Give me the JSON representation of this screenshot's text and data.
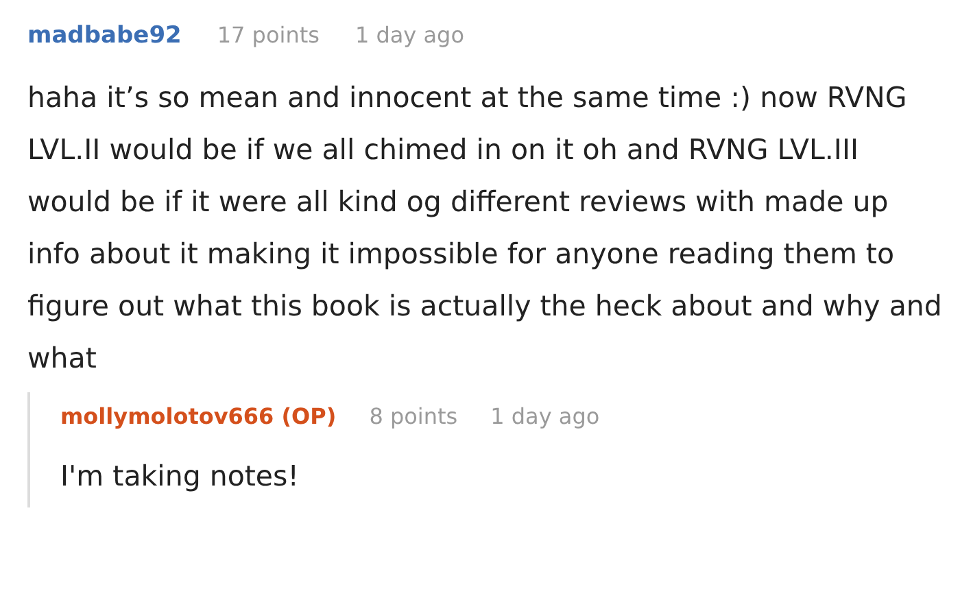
{
  "comments": [
    {
      "username": "madbabe92",
      "op": false,
      "points": "17 points",
      "time": "1 day ago",
      "text": "haha it’s so mean and innocent at the same time :) now RVNG LVL.II would be if we all chimed in on it oh and RVNG LVL.III would be if it were all kind og different reviews with made up info about it making it impossible for anyone reading them to figure out what this book is actually the heck about and why and what",
      "replies": [
        {
          "username": "mollymolotov666 (OP)",
          "op": true,
          "points": "8 points",
          "time": "1 day ago",
          "text": "I'm taking notes!"
        }
      ]
    }
  ]
}
